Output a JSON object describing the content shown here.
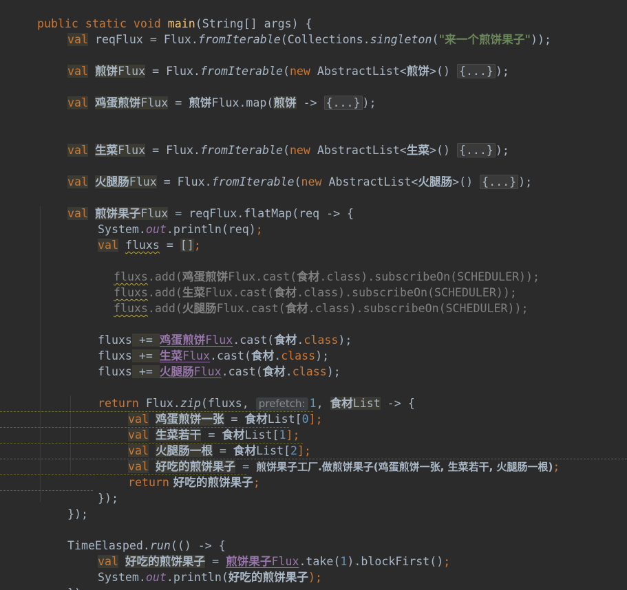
{
  "editor": {
    "language": "Java",
    "theme_colors": {
      "background": "#2b2b2b",
      "default_text": "#a9b7c6",
      "keyword": "#cc7832",
      "method_declaration": "#ffc66d",
      "string": "#6a8759",
      "number": "#6897bb",
      "static_field": "#9876aa",
      "comment": "#808080"
    },
    "code": {
      "l1": {
        "kw": "public static void ",
        "method": "main",
        "rest": "(String[] args) {"
      },
      "l2": {
        "kw": "val",
        "name": "reqFlux",
        "eq": " = Flux.",
        "call": "fromIterable",
        "open": "(Collections.",
        "call2": "singleton",
        "str": "\"来一个煎饼果子\"",
        "close": "));"
      },
      "l3": {
        "kw": "val",
        "name_cjk": "煎饼",
        "name_rest": "Flux",
        "eq": " = Flux.",
        "call": "fromIterable",
        "open": "(",
        "new": "new",
        "type": " AbstractList<",
        "type_cjk": "煎饼",
        "type_close": ">() ",
        "fold": "{...}",
        "close": ");"
      },
      "l4": {
        "kw": "val",
        "name_cjk": "鸡蛋煎饼",
        "name_rest": "Flux",
        "eq": " = ",
        "ref_cjk": "煎饼",
        "ref_rest": "Flux.map(",
        "param_cjk": "煎饼",
        "arrow": " -> ",
        "fold": "{...}",
        "close": ");"
      },
      "l5": {
        "kw": "val",
        "name_cjk": "生菜",
        "name_rest": "Flux",
        "eq": " = Flux.",
        "call": "fromIterable",
        "open": "(",
        "new": "new",
        "type": " AbstractList<",
        "type_cjk": "生菜",
        "type_close": ">() ",
        "fold": "{...}",
        "close": ");"
      },
      "l6": {
        "kw": "val",
        "name_cjk": "火腿肠",
        "name_rest": "Flux",
        "eq": " = Flux.",
        "call": "fromIterable",
        "open": "(",
        "new": "new",
        "type": " AbstractList<",
        "type_cjk": "火腿肠",
        "type_close": ">() ",
        "fold": "{...}",
        "close": ");"
      },
      "l7": {
        "kw": "val",
        "name_cjk": "煎饼果子",
        "name_rest": "Flux",
        "eq": " = reqFlux.flatMap(req -> {"
      },
      "l8": {
        "pre": "System.",
        "field": "out",
        "post": ".println(req)",
        "semi": ";"
      },
      "l9": {
        "kw": "val",
        "name": "fluxs",
        "eq": " = ",
        "val": "[]",
        "semi": ";"
      },
      "c1": {
        "var": "fluxs",
        "pre": ".add(",
        "cjk": "鸡蛋煎饼",
        "mid": "Flux.cast(",
        "cjk2": "食材",
        "post": ".class).subscribeOn(SCHEDULER));"
      },
      "c2": {
        "var": "fluxs",
        "pre": ".add(",
        "cjk": "生菜",
        "mid": "Flux.cast(",
        "cjk2": "食材",
        "post": ".class).subscribeOn(SCHEDULER));"
      },
      "c3": {
        "var": "fluxs",
        "pre": ".add(",
        "cjk": "火腿肠",
        "mid": "Flux.cast(",
        "cjk2": "食材",
        "post": ".class).subscribeOn(SCHEDULER));"
      },
      "p1": {
        "var": "fluxs",
        "op": " += ",
        "cjk": "鸡蛋煎饼",
        "rest": "Flux",
        "mid": ".cast(",
        "cjk2": "食材",
        "dot": ".",
        "kw": "class",
        "close": ");"
      },
      "p2": {
        "var": "fluxs",
        "op": " += ",
        "cjk": "生菜",
        "rest": "Flux",
        "mid": ".cast(",
        "cjk2": "食材",
        "dot": ".",
        "kw": "class",
        "close": ");"
      },
      "p3": {
        "var": "fluxs",
        "op": " += ",
        "cjk": "火腿肠",
        "rest": "Flux",
        "mid": ".cast(",
        "cjk2": "食材",
        "dot": ".",
        "kw": "class",
        "close": ");"
      },
      "r1": {
        "kw": "return",
        "pre": " Flux.",
        "call": "zip",
        "open": "(fluxs, ",
        "hint": "prefetch:",
        "num": "1",
        "comma": ", ",
        "cjk": "食材",
        "rest": "List",
        "arrow": " -> {"
      },
      "z1": {
        "kw": "val",
        "cjk": "鸡蛋煎饼一张",
        "eq": " = ",
        "cjk2": "食材",
        "rest": "List[",
        "num": "0",
        "close": "];"
      },
      "z2": {
        "kw": "val",
        "cjk": "生菜若干",
        "eq": " = ",
        "cjk2": "食材",
        "rest": "List[",
        "num": "1",
        "close": "];"
      },
      "z3": {
        "kw": "val",
        "cjk": "火腿肠一根",
        "eq": " = ",
        "cjk2": "食材",
        "rest": "List[",
        "num": "2",
        "close": "];"
      },
      "z4": {
        "kw": "val",
        "cjk": "好吃的煎饼果子",
        "eq": " = ",
        "cjk2": "煎饼果子工厂.做煎饼果子(鸡蛋煎饼一张, 生菜若干, 火腿肠一根)",
        "close": ";"
      },
      "z5": {
        "kw": "return",
        "cjk": " 好吃的煎饼果子",
        "close": ";"
      },
      "z6": {
        "text": "});"
      },
      "z7": {
        "text": "});"
      },
      "t1": {
        "pre": "TimeElasped.",
        "call": "run",
        "post": "(() -> {"
      },
      "t2": {
        "kw": "val",
        "cjk": "好吃的煎饼果子",
        "eq": " = ",
        "cjk2": "煎饼果子",
        "rest": "Flux",
        "post": ".take(",
        "num": "1",
        "post2": ").blockFirst()",
        "semi": ";"
      },
      "t3": {
        "pre": "System.",
        "field": "out",
        "post": ".println(",
        "cjk": "好吃的煎饼果子",
        "close": ");"
      },
      "t4": {
        "text": "});"
      }
    }
  }
}
